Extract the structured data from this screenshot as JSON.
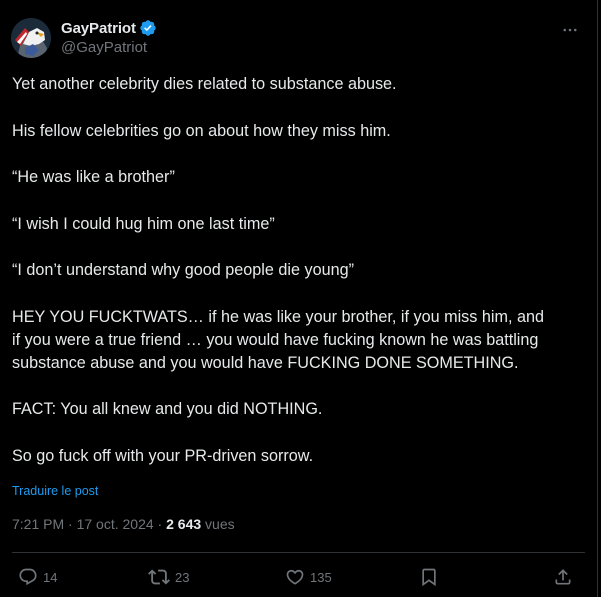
{
  "author": {
    "display_name": "GayPatriot",
    "handle": "@GayPatriot",
    "verified": true,
    "avatar_icon": "eagle-avatar"
  },
  "post": {
    "lines": [
      "Yet another celebrity dies related to substance abuse.",
      "",
      "His fellow celebrities go on about how they miss him.",
      "",
      "“He was like a brother”",
      "",
      "“I wish I could hug him one last time”",
      "",
      "“I don’t understand why good people die young”",
      "",
      "HEY YOU FUCKTWATS… if he was like your brother, if you miss him, and",
      "if you were a true friend … you would have fucking known he was battling",
      "substance abuse and you would have FUCKING DONE SOMETHING.",
      "",
      "FACT:  You all knew and you did NOTHING.",
      "",
      "So go fuck off with your PR-driven sorrow."
    ],
    "translate_label": "Traduire le post"
  },
  "meta": {
    "time": "7:21 PM",
    "separator": " · ",
    "date": "17 oct. 2024",
    "views_count": "2 643",
    "views_label": " vues"
  },
  "actions": {
    "replies": "14",
    "reposts": "23",
    "likes": "135"
  },
  "colors": {
    "background": "#000000",
    "text": "#e7e9ea",
    "secondary": "#71767b",
    "accent": "#1d9bf0",
    "border": "#2f3336"
  }
}
